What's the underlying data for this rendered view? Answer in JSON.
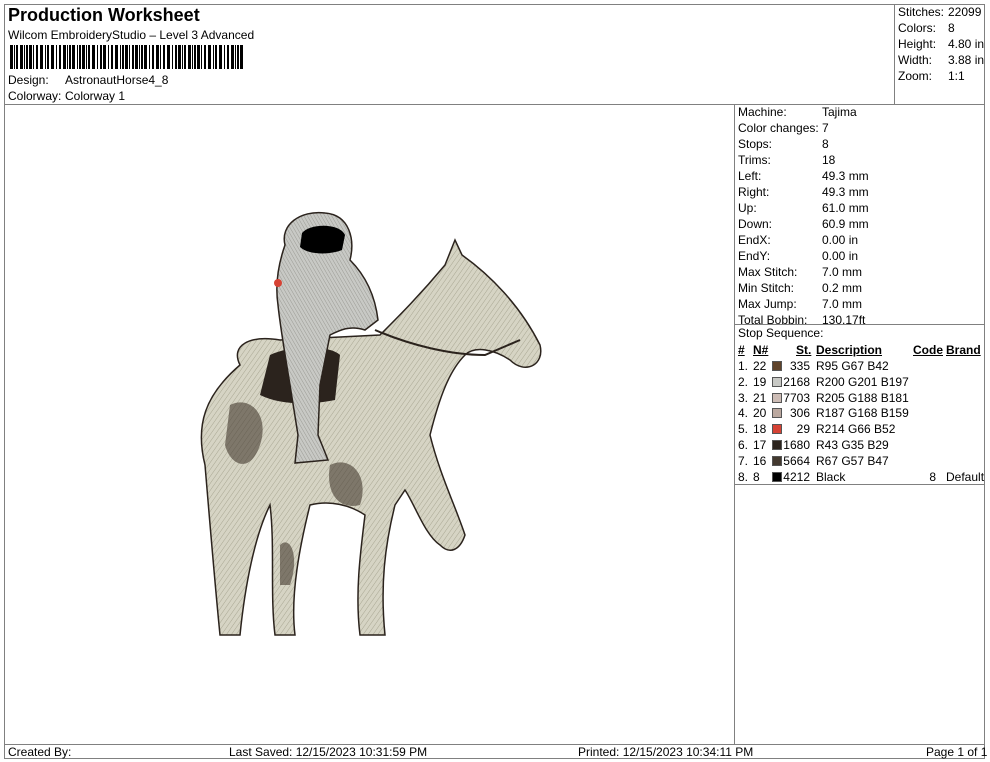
{
  "header": {
    "title": "Production Worksheet",
    "software": "Wilcom EmbroideryStudio – Level 3 Advanced",
    "design_label": "Design:",
    "design_value": "AstronautHorse4_8",
    "colorway_label": "Colorway:",
    "colorway_value": "Colorway 1"
  },
  "summary": [
    {
      "label": "Stitches:",
      "value": "22099"
    },
    {
      "label": "Colors:",
      "value": "8"
    },
    {
      "label": "Height:",
      "value": "4.80 in"
    },
    {
      "label": "Width:",
      "value": "3.88 in"
    },
    {
      "label": "Zoom:",
      "value": "1:1"
    }
  ],
  "machine_info": [
    {
      "label": "Machine:",
      "value": "Tajima"
    },
    {
      "label": "Color changes:",
      "value": "7"
    },
    {
      "label": "Stops:",
      "value": "8"
    },
    {
      "label": "Trims:",
      "value": "18"
    },
    {
      "label": "Left:",
      "value": "49.3 mm"
    },
    {
      "label": "Right:",
      "value": "49.3 mm"
    },
    {
      "label": "Up:",
      "value": "61.0 mm"
    },
    {
      "label": "Down:",
      "value": "60.9 mm"
    },
    {
      "label": "EndX:",
      "value": "0.00 in"
    },
    {
      "label": "EndY:",
      "value": "0.00 in"
    },
    {
      "label": "Max Stitch:",
      "value": "7.0 mm"
    },
    {
      "label": "Min Stitch:",
      "value": "0.2 mm"
    },
    {
      "label": "Max Jump:",
      "value": "7.0 mm"
    },
    {
      "label": "Total Bobbin:",
      "value": "130.17ft"
    }
  ],
  "stop_sequence": {
    "title": "Stop Sequence:",
    "headers": {
      "num": "#",
      "n": "N#",
      "st": "St.",
      "desc": "Description",
      "code": "Code",
      "brand": "Brand"
    },
    "rows": [
      {
        "num": "1.",
        "n": "22",
        "color": "#5F432A",
        "st": "335",
        "desc": "R95 G67 B42",
        "code": "",
        "brand": ""
      },
      {
        "num": "2.",
        "n": "19",
        "color": "#C8C9C5",
        "st": "2168",
        "desc": "R200 G201 B197",
        "code": "",
        "brand": ""
      },
      {
        "num": "3.",
        "n": "21",
        "color": "#CDBCB5",
        "st": "7703",
        "desc": "R205 G188 B181",
        "code": "",
        "brand": ""
      },
      {
        "num": "4.",
        "n": "20",
        "color": "#BBA89F",
        "st": "306",
        "desc": "R187 G168 B159",
        "code": "",
        "brand": ""
      },
      {
        "num": "5.",
        "n": "18",
        "color": "#D64234",
        "st": "29",
        "desc": "R214 G66 B52",
        "code": "",
        "brand": ""
      },
      {
        "num": "6.",
        "n": "17",
        "color": "#2B231D",
        "st": "1680",
        "desc": "R43 G35 B29",
        "code": "",
        "brand": ""
      },
      {
        "num": "7.",
        "n": "16",
        "color": "#43392F",
        "st": "5664",
        "desc": "R67 G57 B47",
        "code": "",
        "brand": ""
      },
      {
        "num": "8.",
        "n": "8",
        "color": "#000000",
        "st": "4212",
        "desc": "Black",
        "code": "8",
        "brand": "Default"
      }
    ]
  },
  "footer": {
    "created_by": "Created By:",
    "last_saved": "Last Saved: 12/15/2023 10:31:59 PM",
    "printed": "Printed: 12/15/2023 10:34:11 PM",
    "page": "Page 1 of 1"
  }
}
